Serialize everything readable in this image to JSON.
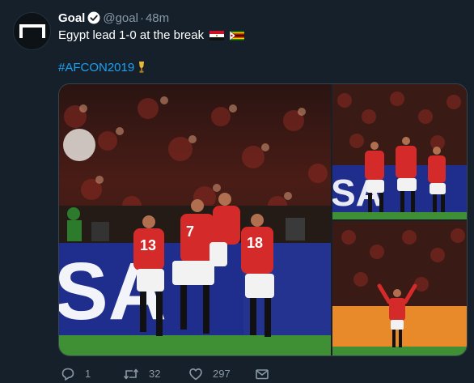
{
  "tweet": {
    "author_name": "Goal",
    "handle": "@goal",
    "separator": "·",
    "time": "48m",
    "text": "Egypt lead 1-0 at the break",
    "hashtag": "#AFCON2019",
    "flags": [
      "egypt-flag-icon",
      "zimbabwe-flag-icon"
    ]
  },
  "media": {
    "photos": [
      "celebration-main-photo",
      "celebration-team-photo",
      "player-celebration-photo"
    ],
    "board_text": "SA"
  },
  "actions": {
    "replies": "1",
    "retweets": "32",
    "likes": "297"
  },
  "colors": {
    "background": "#15202b",
    "text": "#ffffff",
    "muted": "#8899a6",
    "link": "#1da1f2",
    "kit_red": "#d42a2a",
    "board_blue": "#1f2e8c",
    "pitch_green": "#3f8f34"
  }
}
